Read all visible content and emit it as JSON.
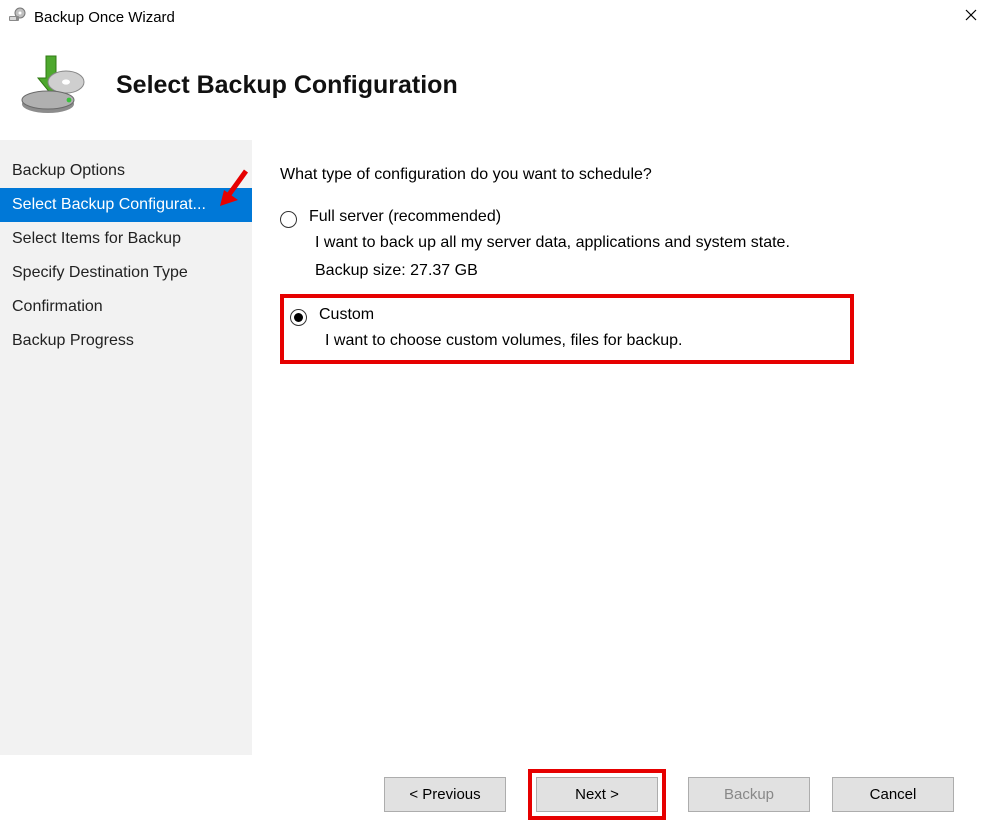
{
  "window": {
    "title": "Backup Once Wizard"
  },
  "header": {
    "page_title": "Select Backup Configuration"
  },
  "sidebar": {
    "items": [
      {
        "label": "Backup Options",
        "active": false
      },
      {
        "label": "Select Backup Configurat...",
        "active": true
      },
      {
        "label": "Select Items for Backup",
        "active": false
      },
      {
        "label": "Specify Destination Type",
        "active": false
      },
      {
        "label": "Confirmation",
        "active": false
      },
      {
        "label": "Backup Progress",
        "active": false
      }
    ]
  },
  "content": {
    "prompt": "What type of configuration do you want to schedule?",
    "options": {
      "full": {
        "label": "Full server (recommended)",
        "desc": "I want to back up all my server data, applications and system state.",
        "extra": "Backup size: 27.37 GB",
        "selected": false
      },
      "custom": {
        "label": "Custom",
        "desc": "I want to choose custom volumes, files for backup.",
        "selected": true
      }
    }
  },
  "footer": {
    "previous": "< Previous",
    "next": "Next >",
    "backup": "Backup",
    "cancel": "Cancel"
  }
}
